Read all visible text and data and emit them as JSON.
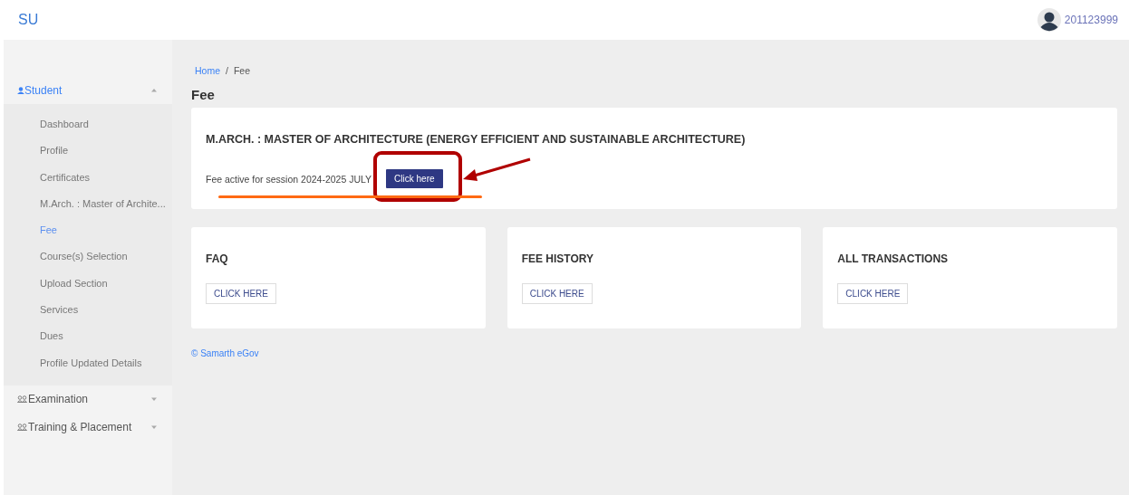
{
  "header": {
    "logo": "SU",
    "user": "201123999"
  },
  "sidebar": {
    "sections": [
      {
        "label": "Student",
        "kind": "person",
        "expanded": true,
        "selected": true,
        "children": [
          {
            "label": "Dashboard",
            "selected": false
          },
          {
            "label": "Profile",
            "selected": false
          },
          {
            "label": "Certificates",
            "selected": false
          },
          {
            "label": "M.Arch. : Master of Archite...",
            "selected": false
          },
          {
            "label": "Fee",
            "selected": true
          },
          {
            "label": "Course(s) Selection",
            "selected": false
          },
          {
            "label": "Upload Section",
            "selected": false
          },
          {
            "label": "Services",
            "selected": false
          },
          {
            "label": "Dues",
            "selected": false
          },
          {
            "label": "Profile Updated Details",
            "selected": false
          }
        ]
      },
      {
        "label": "Examination",
        "kind": "people",
        "expanded": false,
        "selected": false
      },
      {
        "label": "Training & Placement",
        "kind": "people",
        "expanded": false,
        "selected": false
      }
    ]
  },
  "breadcrumb": [
    {
      "label": "Home",
      "kind": "link"
    },
    {
      "label": "/",
      "kind": "separator"
    },
    {
      "label": "Fee",
      "kind": "current"
    }
  ],
  "page_title": "Fee",
  "program_card": {
    "title": "M.ARCH. : MASTER OF ARCHITECTURE (ENERGY EFFICIENT AND SUSTAINABLE ARCHITECTURE)",
    "session_text": "Fee active for session 2024-2025 JULY",
    "button": "Click here"
  },
  "annotations": [
    {
      "kind": "box",
      "color": "#b00000"
    },
    {
      "kind": "arrow",
      "color": "#b00000"
    },
    {
      "kind": "underline",
      "color": "#ff6a13"
    }
  ],
  "cards": [
    {
      "title": "FAQ",
      "button": "CLICK HERE"
    },
    {
      "title": "FEE HISTORY",
      "button": "CLICK HERE"
    },
    {
      "title": "ALL TRANSACTIONS",
      "button": "CLICK HERE"
    }
  ],
  "footer": "© Samarth eGov"
}
